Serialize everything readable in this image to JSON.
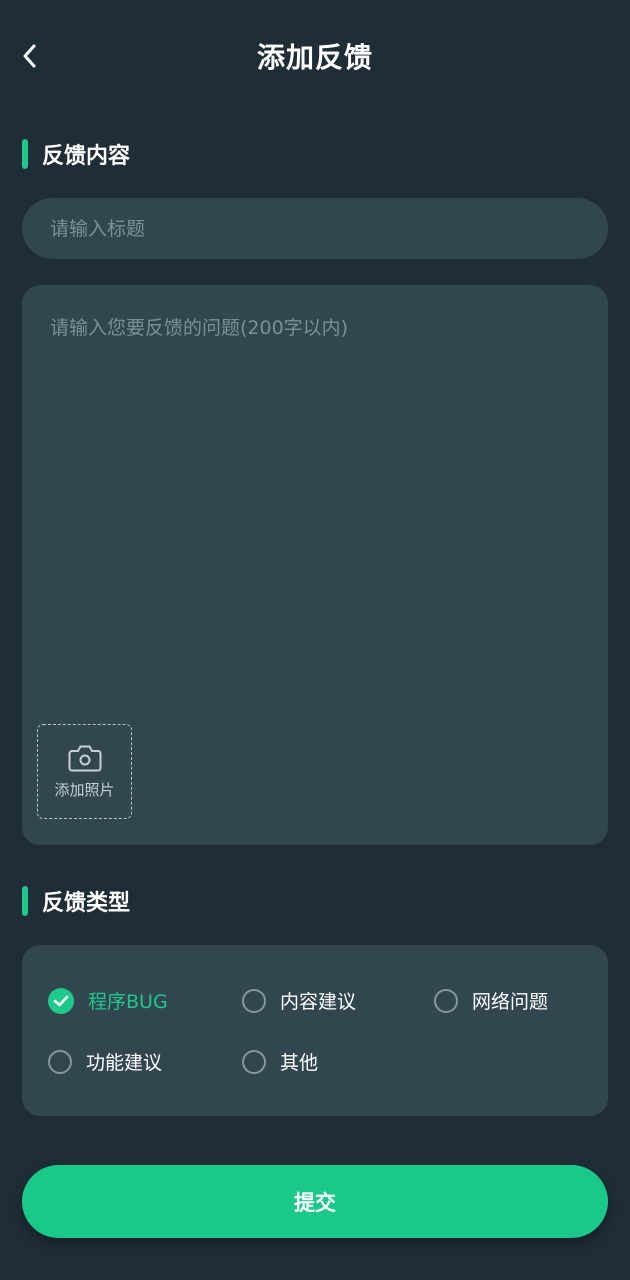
{
  "header": {
    "title": "添加反馈",
    "back_icon": "chevron-left-icon"
  },
  "content_section": {
    "title": "反馈内容",
    "title_input_placeholder": "请输入标题",
    "title_input_value": "",
    "content_placeholder": "请输入您要反馈的问题(200字以内)",
    "content_value": "",
    "add_photo_label": "添加照片",
    "add_photo_icon": "camera-icon"
  },
  "type_section": {
    "title": "反馈类型",
    "options": [
      {
        "label": "程序BUG",
        "selected": true
      },
      {
        "label": "内容建议",
        "selected": false
      },
      {
        "label": "网络问题",
        "selected": false
      },
      {
        "label": "功能建议",
        "selected": false
      },
      {
        "label": "其他",
        "selected": false
      }
    ]
  },
  "submit_label": "提交",
  "colors": {
    "accent": "#1ec98b",
    "background": "#1f2d36",
    "card": "#31464f"
  }
}
